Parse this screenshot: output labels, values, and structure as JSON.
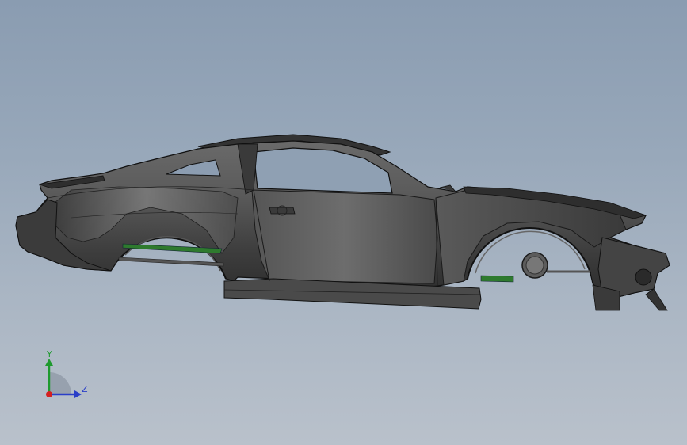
{
  "viewport": {
    "model_name": "car-body-shell",
    "background_top": "#8a9cb1",
    "background_bottom": "#b9c1cb",
    "body_color": "#4a4a4a",
    "accent_color": "#2e7a2e"
  },
  "triad": {
    "y_label": "Y",
    "z_label": "Z",
    "y_color": "#1e9a2e",
    "z_color": "#2a3ec8",
    "origin_color": "#d42020"
  }
}
